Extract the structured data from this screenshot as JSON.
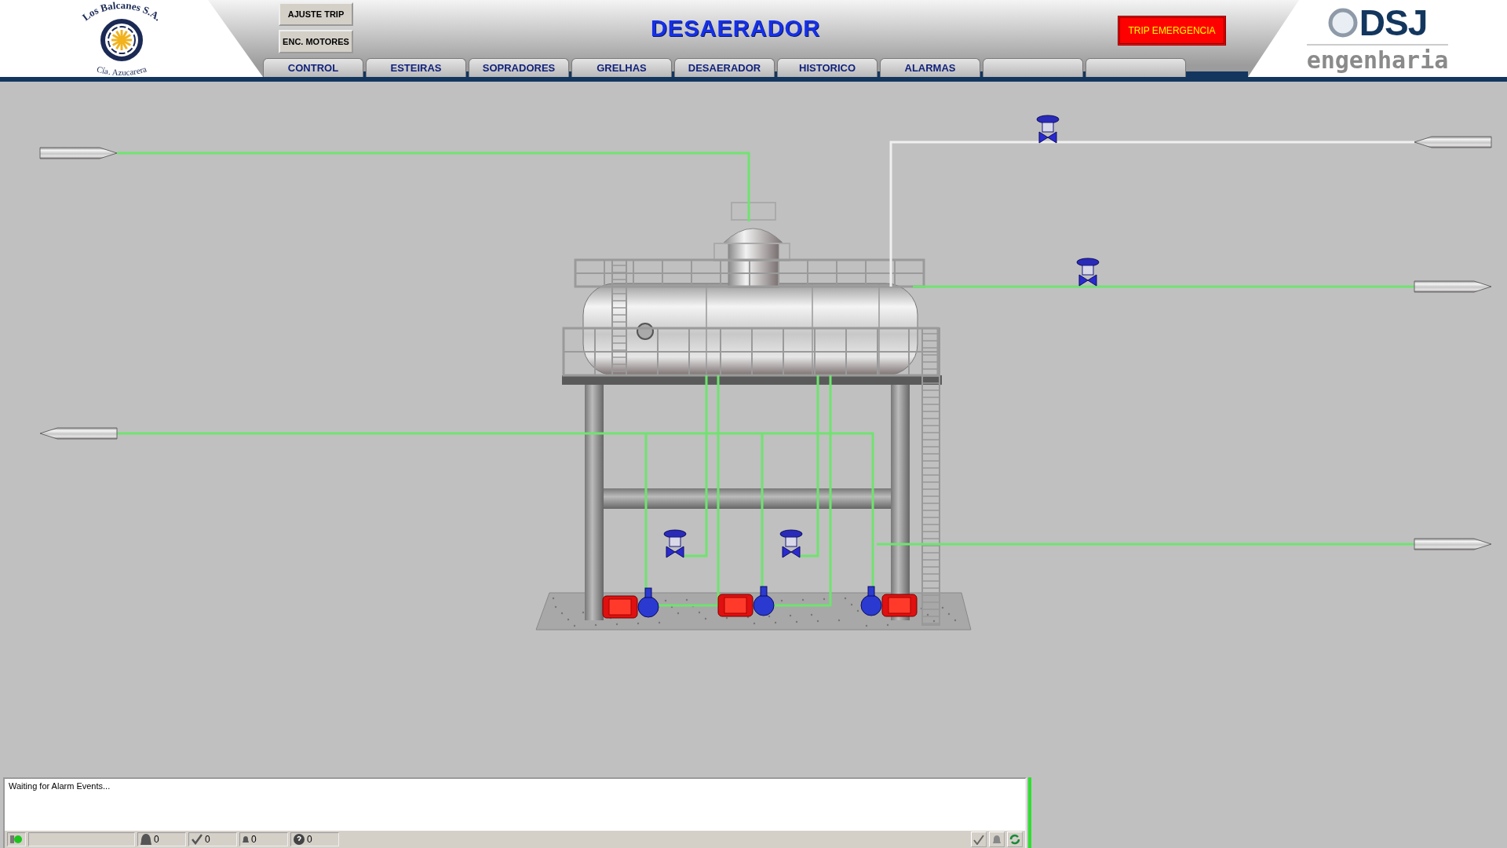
{
  "logo": {
    "name": "Los Balcanes S.A.",
    "subtitle": "Cía. Azucarera"
  },
  "buttons": [
    {
      "label": "AJUSTE TRIP"
    },
    {
      "label": "ENC. MOTORES"
    }
  ],
  "title": "DESAERADOR",
  "trip_button": {
    "label": "TRIP EMERGENCIA"
  },
  "tabs": [
    {
      "label": "CONTROL"
    },
    {
      "label": "ESTEIRAS"
    },
    {
      "label": "SOPRADORES"
    },
    {
      "label": "GRELHAS"
    },
    {
      "label": "DESAERADOR"
    },
    {
      "label": "HISTORICO"
    },
    {
      "label": "ALARMAS"
    }
  ],
  "brand": {
    "name": "DSJ",
    "tagline": "engenharia"
  },
  "alarm_panel": {
    "message": "Waiting for Alarm Events...",
    "status_counts": [
      {
        "kind": "bell",
        "value": "0"
      },
      {
        "kind": "acknowledged",
        "value": "0"
      },
      {
        "kind": "small-bell",
        "value": "0"
      },
      {
        "kind": "unknown",
        "value": "0"
      }
    ]
  }
}
